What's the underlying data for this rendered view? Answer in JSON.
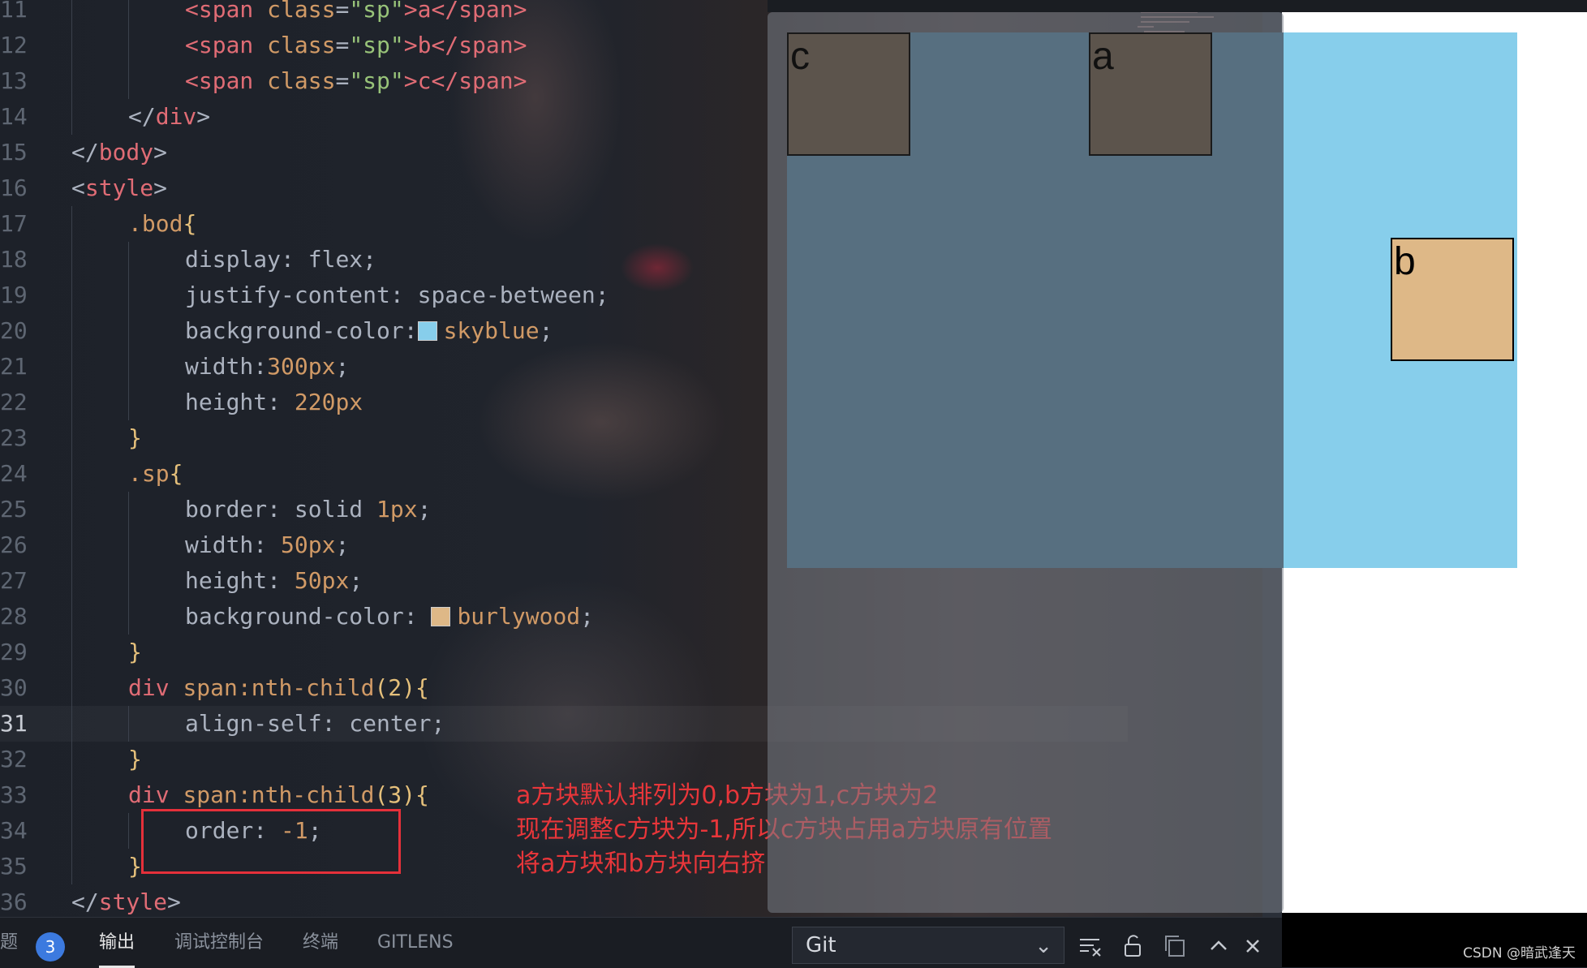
{
  "editor": {
    "lines": [
      {
        "n": "11",
        "indent": 2,
        "tokens": [
          {
            "t": "<span ",
            "c": "tag"
          },
          {
            "t": "class",
            "c": "attr"
          },
          {
            "t": "=",
            "c": "punc"
          },
          {
            "t": "\"sp\"",
            "c": "str"
          },
          {
            "t": ">a</",
            "c": "tag"
          },
          {
            "t": "span",
            "c": "tag"
          },
          {
            "t": ">",
            "c": "tag"
          }
        ]
      },
      {
        "n": "12",
        "indent": 2,
        "tokens": [
          {
            "t": "<span ",
            "c": "tag"
          },
          {
            "t": "class",
            "c": "attr"
          },
          {
            "t": "=",
            "c": "punc"
          },
          {
            "t": "\"sp\"",
            "c": "str"
          },
          {
            "t": ">b</",
            "c": "tag"
          },
          {
            "t": "span",
            "c": "tag"
          },
          {
            "t": ">",
            "c": "tag"
          }
        ]
      },
      {
        "n": "13",
        "indent": 2,
        "tokens": [
          {
            "t": "<span ",
            "c": "tag"
          },
          {
            "t": "class",
            "c": "attr"
          },
          {
            "t": "=",
            "c": "punc"
          },
          {
            "t": "\"sp\"",
            "c": "str"
          },
          {
            "t": ">c</",
            "c": "tag"
          },
          {
            "t": "span",
            "c": "tag"
          },
          {
            "t": ">",
            "c": "tag"
          }
        ]
      },
      {
        "n": "14",
        "indent": 1,
        "tokens": [
          {
            "t": "</",
            "c": "punc"
          },
          {
            "t": "div",
            "c": "tag"
          },
          {
            "t": ">",
            "c": "punc"
          }
        ]
      },
      {
        "n": "15",
        "indent": 0,
        "tokens": [
          {
            "t": "</",
            "c": "punc"
          },
          {
            "t": "body",
            "c": "tag"
          },
          {
            "t": ">",
            "c": "punc"
          }
        ]
      },
      {
        "n": "16",
        "indent": 0,
        "tokens": [
          {
            "t": "<",
            "c": "punc"
          },
          {
            "t": "style",
            "c": "tag"
          },
          {
            "t": ">",
            "c": "punc"
          }
        ]
      },
      {
        "n": "17",
        "indent": 1,
        "tokens": [
          {
            "t": ".bod",
            "c": "sel"
          },
          {
            "t": "{",
            "c": "brace"
          }
        ]
      },
      {
        "n": "18",
        "indent": 2,
        "tokens": [
          {
            "t": "display",
            "c": "prop"
          },
          {
            "t": ": ",
            "c": "punc"
          },
          {
            "t": "flex",
            "c": "plain"
          },
          {
            "t": ";",
            "c": "punc"
          }
        ]
      },
      {
        "n": "19",
        "indent": 2,
        "tokens": [
          {
            "t": "justify-content",
            "c": "prop"
          },
          {
            "t": ": ",
            "c": "punc"
          },
          {
            "t": "space-between",
            "c": "plain"
          },
          {
            "t": ";",
            "c": "punc"
          }
        ]
      },
      {
        "n": "20",
        "indent": 2,
        "tokens": [
          {
            "t": "background-color",
            "c": "prop"
          },
          {
            "t": ":",
            "c": "punc"
          },
          {
            "swatch": "#87ceeb"
          },
          {
            "t": "skyblue",
            "c": "val"
          },
          {
            "t": ";",
            "c": "punc"
          }
        ]
      },
      {
        "n": "21",
        "indent": 2,
        "tokens": [
          {
            "t": "width",
            "c": "prop"
          },
          {
            "t": ":",
            "c": "punc"
          },
          {
            "t": "300px",
            "c": "num"
          },
          {
            "t": ";",
            "c": "punc"
          }
        ]
      },
      {
        "n": "22",
        "indent": 2,
        "tokens": [
          {
            "t": "height",
            "c": "prop"
          },
          {
            "t": ": ",
            "c": "punc"
          },
          {
            "t": "220px",
            "c": "num"
          }
        ]
      },
      {
        "n": "23",
        "indent": 1,
        "tokens": [
          {
            "t": "}",
            "c": "brace"
          }
        ]
      },
      {
        "n": "24",
        "indent": 1,
        "tokens": [
          {
            "t": ".sp",
            "c": "sel"
          },
          {
            "t": "{",
            "c": "brace"
          }
        ]
      },
      {
        "n": "25",
        "indent": 2,
        "tokens": [
          {
            "t": "border",
            "c": "prop"
          },
          {
            "t": ": ",
            "c": "punc"
          },
          {
            "t": "solid ",
            "c": "plain"
          },
          {
            "t": "1px",
            "c": "num"
          },
          {
            "t": ";",
            "c": "punc"
          }
        ]
      },
      {
        "n": "26",
        "indent": 2,
        "tokens": [
          {
            "t": "width",
            "c": "prop"
          },
          {
            "t": ": ",
            "c": "punc"
          },
          {
            "t": "50px",
            "c": "num"
          },
          {
            "t": ";",
            "c": "punc"
          }
        ]
      },
      {
        "n": "27",
        "indent": 2,
        "tokens": [
          {
            "t": "height",
            "c": "prop"
          },
          {
            "t": ": ",
            "c": "punc"
          },
          {
            "t": "50px",
            "c": "num"
          },
          {
            "t": ";",
            "c": "punc"
          }
        ]
      },
      {
        "n": "28",
        "indent": 2,
        "tokens": [
          {
            "t": "background-color",
            "c": "prop"
          },
          {
            "t": ": ",
            "c": "punc"
          },
          {
            "swatch": "#deb887"
          },
          {
            "t": "burlywood",
            "c": "val"
          },
          {
            "t": ";",
            "c": "punc"
          }
        ]
      },
      {
        "n": "29",
        "indent": 1,
        "tokens": [
          {
            "t": "}",
            "c": "brace"
          }
        ]
      },
      {
        "n": "30",
        "indent": 1,
        "tokens": [
          {
            "t": "div ",
            "c": "tag"
          },
          {
            "t": "span:nth-child",
            "c": "sel"
          },
          {
            "t": "(2)",
            "c": "brace"
          },
          {
            "t": "{",
            "c": "brace"
          }
        ]
      },
      {
        "n": "31",
        "indent": 2,
        "current": true,
        "tokens": [
          {
            "t": "align-self",
            "c": "prop"
          },
          {
            "t": ": ",
            "c": "punc"
          },
          {
            "t": "center",
            "c": "plain"
          },
          {
            "t": ";",
            "c": "punc"
          }
        ]
      },
      {
        "n": "32",
        "indent": 1,
        "tokens": [
          {
            "t": "}",
            "c": "brace"
          }
        ]
      },
      {
        "n": "33",
        "indent": 1,
        "tokens": [
          {
            "t": "div ",
            "c": "tag"
          },
          {
            "t": "span:nth-child",
            "c": "sel"
          },
          {
            "t": "(3)",
            "c": "brace"
          },
          {
            "t": "{",
            "c": "brace"
          }
        ]
      },
      {
        "n": "34",
        "indent": 2,
        "tokens": [
          {
            "t": "order",
            "c": "prop"
          },
          {
            "t": ": ",
            "c": "punc"
          },
          {
            "t": "-1",
            "c": "num"
          },
          {
            "t": ";",
            "c": "punc"
          }
        ]
      },
      {
        "n": "35",
        "indent": 1,
        "tokens": [
          {
            "t": "}",
            "c": "brace"
          }
        ]
      },
      {
        "n": "36",
        "indent": 0,
        "tokens": [
          {
            "t": "</",
            "c": "punc"
          },
          {
            "t": "style",
            "c": "tag"
          },
          {
            "t": ">",
            "c": "punc"
          }
        ]
      }
    ]
  },
  "annotation": {
    "text": "a方块默认排列为0,b方块为1,c方块为2\n现在调整c方块为-1,所以c方块占用a方块原有位置\n将a方块和b方块向右挤",
    "color": "#e8363a"
  },
  "preview": {
    "container_color": "#87ceeb",
    "box_color": "#deb887",
    "boxes": [
      {
        "label": "c"
      },
      {
        "label": "a"
      },
      {
        "label": "b"
      }
    ]
  },
  "panel": {
    "tabs": [
      {
        "label": "题",
        "name": "tab-problems"
      },
      {
        "label": "输出",
        "name": "tab-output",
        "active": true
      },
      {
        "label": "调试控制台",
        "name": "tab-debug-console"
      },
      {
        "label": "终端",
        "name": "tab-terminal"
      },
      {
        "label": "GITLENS",
        "name": "tab-gitlens"
      }
    ],
    "problems_count": "3",
    "output_channel": "Git",
    "icons": [
      "clear-output-icon",
      "lock-icon",
      "copy-icon",
      "chevron-up-icon",
      "close-icon"
    ]
  },
  "watermark": "CSDN @暗武逢天"
}
